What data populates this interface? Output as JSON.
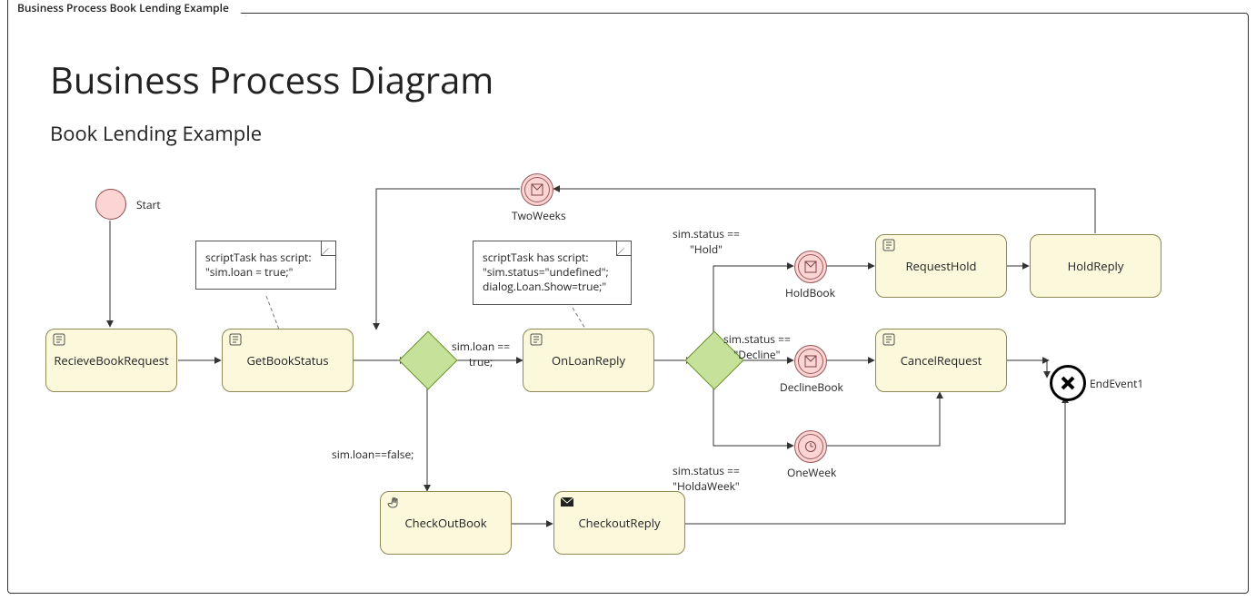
{
  "frame_tab": "Business Process Book Lending Example",
  "title": "Business Process Diagram",
  "subtitle": "Book Lending Example",
  "nodes": {
    "start": "Start",
    "recieve": "RecieveBookRequest",
    "getstatus": "GetBookStatus",
    "onloan": "OnLoanReply",
    "checkout": "CheckOutBook",
    "checkoutreply": "CheckoutReply",
    "requesthold": "RequestHold",
    "holdreply": "HoldReply",
    "cancelreq": "CancelRequest",
    "endevent": "EndEvent1",
    "twoweeks": "TwoWeeks",
    "holdbook": "HoldBook",
    "decline": "DeclineBook",
    "oneweek": "OneWeek",
    "note1": "scriptTask has script:\n\"sim.loan = true;\"",
    "note2": "scriptTask has script:\n\"sim.status=\"undefined\";\ndialog.Loan.Show=true;\""
  },
  "edges": {
    "loan_true": "sim.loan ==\ntrue;",
    "loan_false": "sim.loan==false;",
    "status_hold": "sim.status ==\n\"Hold\"",
    "status_decline": "sim.status ==\n\"Decline\"",
    "status_holdweek": "sim.status ==\n\"HoldaWeek\""
  }
}
